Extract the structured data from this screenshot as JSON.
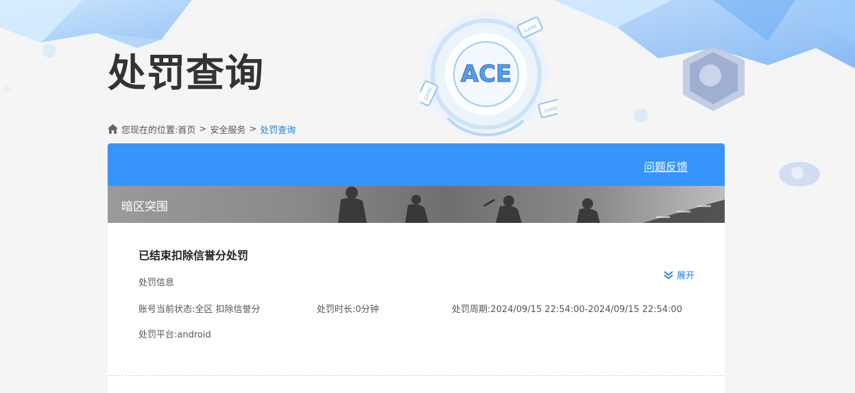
{
  "page": {
    "title": "处罚查询"
  },
  "breadcrumb": {
    "prefix": "您现在的位置:",
    "items": [
      "首页",
      "安全服务",
      "处罚查询"
    ],
    "separator": ">"
  },
  "panel": {
    "feedback_label": "问题反馈",
    "game_name": "暗区突围"
  },
  "record": {
    "title": "已结束扣除信誉分处罚",
    "section_label": "处罚信息",
    "status": "账号当前状态:全区 扣除信誉分",
    "duration": "处罚时长:0分钟",
    "period": "处罚周期:2024/09/15 22:54:00-2024/09/15 22:54:00",
    "platform": "处罚平台:android",
    "expand_label": "展开"
  },
  "emblem": {
    "logo_text": "ACE",
    "badge_text": "GAME"
  },
  "colors": {
    "accent": "#3694fb",
    "link": "#1f7ed3",
    "title": "#333333"
  }
}
